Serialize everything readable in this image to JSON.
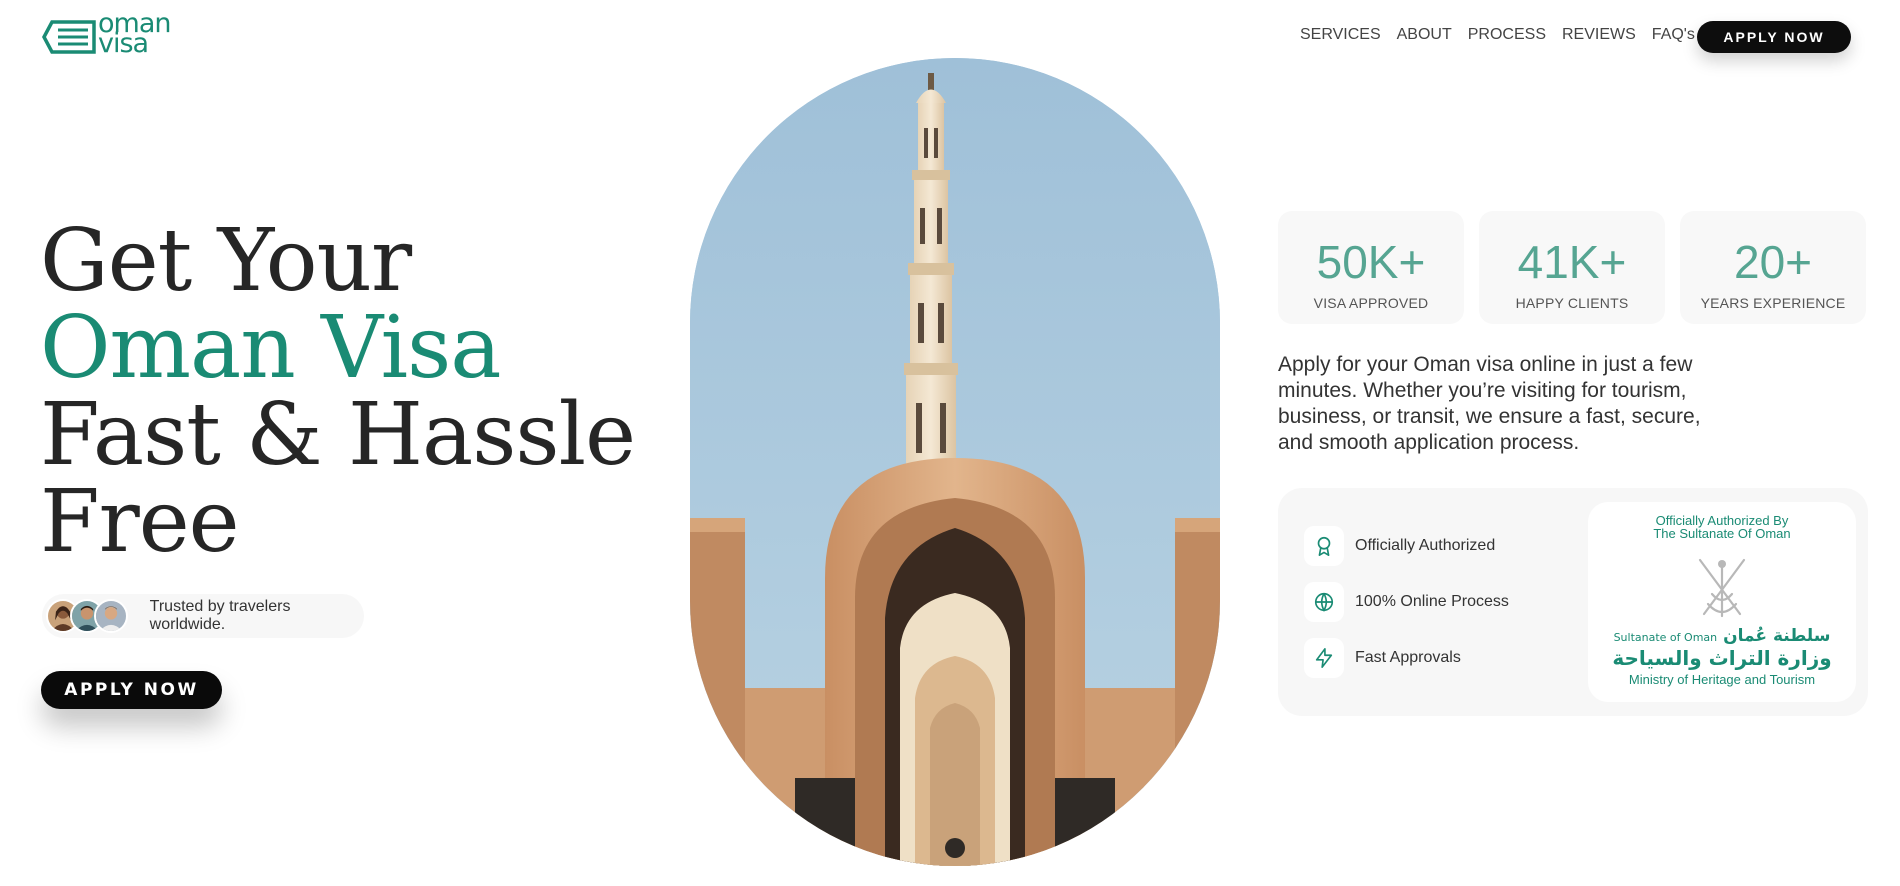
{
  "header": {
    "logo_line1": "oman",
    "logo_line2": "visa",
    "nav": [
      "SERVICES",
      "ABOUT",
      "PROCESS",
      "REVIEWS",
      "FAQ's"
    ],
    "cta_label": "APPLY NOW"
  },
  "hero": {
    "title_line1": "Get Your",
    "title_line2": "Oman Visa",
    "title_line3": "Fast & Hassle",
    "title_line4": "Free",
    "trust_text": "Trusted by travelers worldwide.",
    "cta_label": "APPLY NOW"
  },
  "stats": [
    {
      "value": "50K+",
      "label": "VISA APPROVED"
    },
    {
      "value": "41K+",
      "label": "HAPPY CLIENTS"
    },
    {
      "value": "20+",
      "label": "YEARS EXPERIENCE"
    }
  ],
  "description": "Apply for your Oman visa online in just a few minutes. Whether you’re visiting for tourism, business, or transit, we ensure a fast, secure, and smooth application process.",
  "features": [
    {
      "label": "Officially Authorized",
      "icon": "award-icon"
    },
    {
      "label": "100% Online Process",
      "icon": "globe-icon"
    },
    {
      "label": "Fast Approvals",
      "icon": "lightning-icon"
    }
  ],
  "authority": {
    "title_line1": "Officially Authorized By",
    "title_line2": "The Sultanate Of Oman",
    "sultanate_en": "Sultanate of Oman",
    "sultanate_ar": "سلطنة عُمان",
    "ministry_ar": "وزارة التراث والسياحة",
    "ministry_en": "Ministry of Heritage and Tourism"
  },
  "colors": {
    "accent": "#1a8b74",
    "stat_number": "#56a592",
    "dark_button": "#0d0d0d"
  }
}
